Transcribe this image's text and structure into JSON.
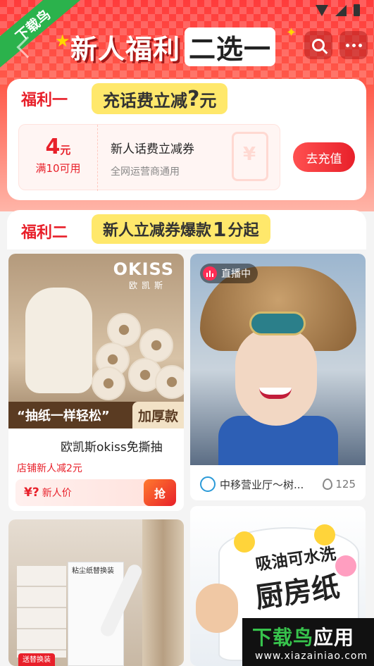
{
  "status_bar": {
    "icons": [
      "wifi-icon",
      "signal-icon",
      "battery-icon"
    ]
  },
  "ribbon": {
    "text": "下载鸟"
  },
  "header": {
    "title_part1": "新人福利",
    "title_part2": "二选一",
    "search_icon": "search-icon",
    "more_icon": "more-icon"
  },
  "benefit1": {
    "tag": "福利一",
    "headline_pre": "充话费立减",
    "headline_q": "?",
    "headline_post": "元",
    "coupon": {
      "amount": "4",
      "unit": "元",
      "condition": "满10可用",
      "title": "新人话费立减券",
      "subtitle": "全网运营商通用"
    },
    "button": "去充值"
  },
  "benefit2": {
    "tag": "福利二",
    "headline_pre": "新人立减券爆款",
    "headline_num": "1",
    "headline_post": "分起"
  },
  "products": {
    "p1": {
      "brand": "OKISS",
      "brand_sub": "欧凯斯",
      "slogan": "“抽纸一样轻松”",
      "badge": "加厚款",
      "name": "欧凯斯okiss免撕抽",
      "promo": "店铺新人减2元",
      "price_symbol": "¥?",
      "price_label": "新人价",
      "grab": "抢"
    },
    "p2": {
      "live_label": "直播中",
      "shop": "中移营业厅～树...",
      "heat": "125"
    },
    "p3": {
      "pack_label": "粘尘纸替换装",
      "tag": "送替换装"
    },
    "p4": {
      "line1": "吸油可水洗",
      "line2": "厨房纸"
    }
  },
  "watermark": {
    "title_a": "下载鸟",
    "title_b": "应用",
    "url": "www.xiazainiao.com"
  }
}
